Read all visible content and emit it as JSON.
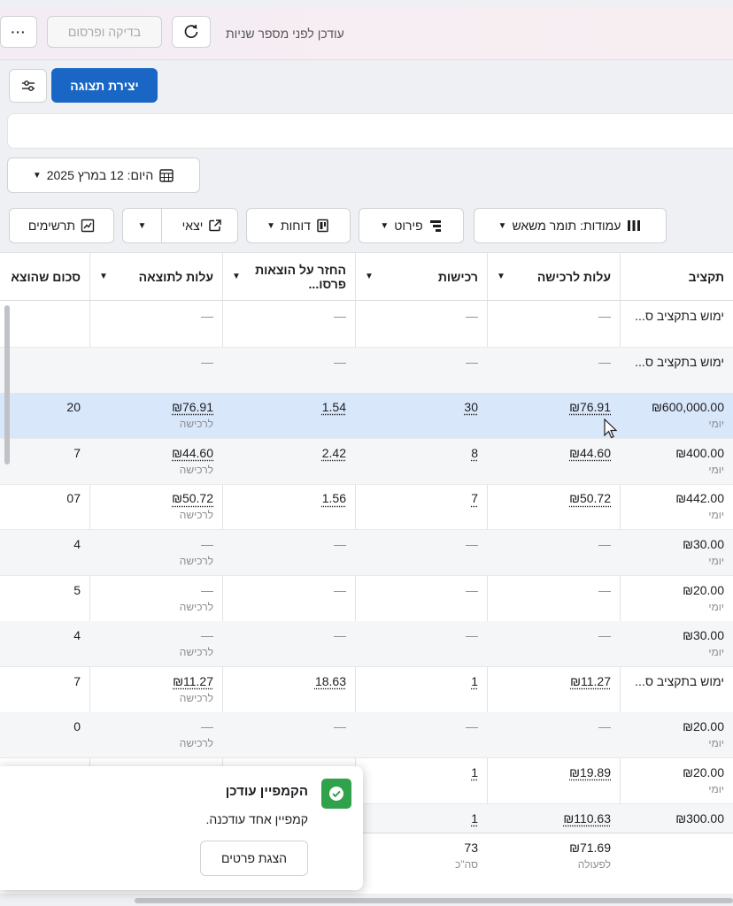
{
  "topbar": {
    "more_label": "···",
    "review_publish_label": "בדיקה ופרסום",
    "updated_text": "עודכן לפני מספר שניות"
  },
  "toolbar": {
    "create_view_label": "יצירת תצוגה",
    "date_label": "היום: 12 במרץ 2025",
    "columns_label": "עמודות: תומר משאש",
    "breakdown_label": "פירוט",
    "reports_label": "דוחות",
    "export_label": "יצאי",
    "charts_label": "תרשימים"
  },
  "table": {
    "headers": {
      "budget": "תקציב",
      "cost_per_purchase": "עלות לרכישה",
      "purchases": "רכישות",
      "roas": "החזר על הוצאות פרסו...",
      "cost_per_result": "עלות לתוצאה",
      "amount_spent": "סכום שהוצא"
    },
    "rows": [
      {
        "budget": "ימוש בתקציב ס...",
        "budget_sub": "",
        "cpp": "—",
        "purchases": "—",
        "roas": "—",
        "cpr": "—",
        "cpr_sub": "",
        "spent": "",
        "style": "normal"
      },
      {
        "budget": "ימוש בתקציב ס...",
        "budget_sub": "",
        "cpp": "—",
        "purchases": "—",
        "roas": "—",
        "cpr": "—",
        "cpr_sub": "",
        "spent": "",
        "style": "alt"
      },
      {
        "budget": "₪600,000.00",
        "budget_sub": "יומי",
        "cpp": "₪76.91",
        "purchases": "30",
        "roas": "1.54",
        "cpr": "₪76.91",
        "cpr_sub": "לרכישה",
        "spent": "20",
        "style": "sel"
      },
      {
        "budget": "₪400.00",
        "budget_sub": "יומי",
        "cpp": "₪44.60",
        "purchases": "8",
        "roas": "2.42",
        "cpr": "₪44.60",
        "cpr_sub": "לרכישה",
        "spent": "7",
        "style": "alt"
      },
      {
        "budget": "₪442.00",
        "budget_sub": "יומי",
        "cpp": "₪50.72",
        "purchases": "7",
        "roas": "1.56",
        "cpr": "₪50.72",
        "cpr_sub": "לרכישה",
        "spent": "07",
        "style": "normal"
      },
      {
        "budget": "₪30.00",
        "budget_sub": "יומי",
        "cpp": "—",
        "purchases": "—",
        "roas": "—",
        "cpr": "—",
        "cpr_sub": "לרכישה",
        "spent": "4",
        "style": "alt"
      },
      {
        "budget": "₪20.00",
        "budget_sub": "יומי",
        "cpp": "—",
        "purchases": "—",
        "roas": "—",
        "cpr": "—",
        "cpr_sub": "לרכישה",
        "spent": "5",
        "style": "normal"
      },
      {
        "budget": "₪30.00",
        "budget_sub": "יומי",
        "cpp": "—",
        "purchases": "—",
        "roas": "—",
        "cpr": "—",
        "cpr_sub": "לרכישה",
        "spent": "4",
        "style": "alt"
      },
      {
        "budget": "ימוש בתקציב ס...",
        "budget_sub": "",
        "cpp": "₪11.27",
        "purchases": "1",
        "roas": "18.63",
        "cpr": "₪11.27",
        "cpr_sub": "לרכישה",
        "spent": "7",
        "style": "normal"
      },
      {
        "budget": "₪20.00",
        "budget_sub": "יומי",
        "cpp": "—",
        "purchases": "—",
        "roas": "—",
        "cpr": "—",
        "cpr_sub": "לרכישה",
        "spent": "0",
        "style": "alt"
      },
      {
        "budget": "₪20.00",
        "budget_sub": "יומי",
        "cpp": "₪19.89",
        "purchases": "1",
        "roas": "",
        "cpr": "",
        "cpr_sub": "",
        "spent": "",
        "style": "normal"
      },
      {
        "budget": "₪300.00",
        "budget_sub": "",
        "cpp": "₪110.63",
        "purchases": "1",
        "roas": "",
        "cpr": "",
        "cpr_sub": "",
        "spent": "",
        "style": "alt"
      }
    ],
    "footer": {
      "cpp": "₪71.69",
      "cpp_sub": "לפעולה",
      "purchases": "73",
      "purchases_sub": "סה\"כ"
    }
  },
  "toast": {
    "title": "הקמפיין עודכן",
    "body": "קמפיין אחד עודכנה.",
    "button_label": "הצגת פרטים"
  },
  "colors": {
    "primary": "#1a66c5",
    "success": "#31a24c",
    "selected_row": "#d9e7fb"
  }
}
